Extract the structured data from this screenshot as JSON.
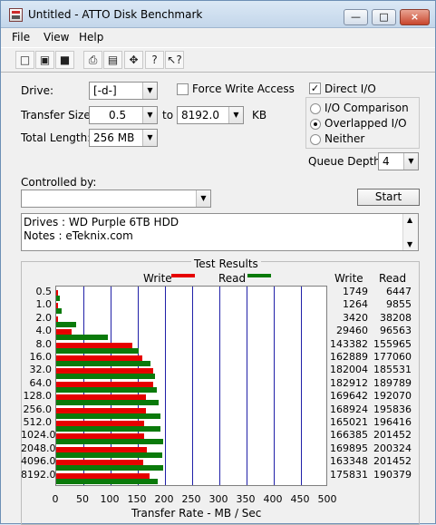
{
  "window": {
    "title": "Untitled - ATTO Disk Benchmark"
  },
  "menu": [
    "File",
    "View",
    "Help"
  ],
  "toolbar": {
    "icons": [
      "new-icon",
      "open-icon",
      "save-icon",
      "print-icon",
      "print-preview-icon",
      "move-icon",
      "help-icon",
      "context-help-icon"
    ]
  },
  "drive": {
    "label": "Drive:",
    "value": "[-d-]"
  },
  "force_write_access": {
    "label": "Force Write Access",
    "checked": false
  },
  "direct_io": {
    "label": "Direct I/O",
    "checked": true,
    "mark": "✓"
  },
  "transfer_size": {
    "label": "Transfer Size:",
    "from": "0.5",
    "to_label": "to",
    "to": "8192.0",
    "unit": "KB"
  },
  "total_length": {
    "label": "Total Length:",
    "value": "256 MB"
  },
  "io_mode": {
    "options": [
      {
        "label": "I/O Comparison",
        "selected": false
      },
      {
        "label": "Overlapped I/O",
        "selected": true
      },
      {
        "label": "Neither",
        "selected": false
      }
    ]
  },
  "queue_depth": {
    "label": "Queue Depth:",
    "value": "4"
  },
  "controlled_by": {
    "label": "Controlled by:",
    "value": ""
  },
  "start_button": "Start",
  "notes": {
    "line1": "Drives : WD Purple 6TB HDD",
    "line2": "Notes :  eTeknix.com"
  },
  "results": {
    "title": "Test Results",
    "legend": {
      "write": "Write",
      "read": "Read",
      "write_color": "#e60000",
      "read_color": "#0a7a0a"
    },
    "columns": {
      "write": "Write",
      "read": "Read"
    },
    "axis_label": "Transfer Rate - MB / Sec",
    "axis_ticks": [
      "0",
      "50",
      "100",
      "150",
      "200",
      "250",
      "300",
      "350",
      "400",
      "450",
      "500"
    ],
    "axis_max": 500,
    "rows": [
      {
        "size": "0.5",
        "write": 1749,
        "read": 6447
      },
      {
        "size": "1.0",
        "write": 1264,
        "read": 9855
      },
      {
        "size": "2.0",
        "write": 3420,
        "read": 38208
      },
      {
        "size": "4.0",
        "write": 29460,
        "read": 96563
      },
      {
        "size": "8.0",
        "write": 143382,
        "read": 155965
      },
      {
        "size": "16.0",
        "write": 162889,
        "read": 177060
      },
      {
        "size": "32.0",
        "write": 182004,
        "read": 185531
      },
      {
        "size": "64.0",
        "write": 182912,
        "read": 189789
      },
      {
        "size": "128.0",
        "write": 169642,
        "read": 192070
      },
      {
        "size": "256.0",
        "write": 168924,
        "read": 195836
      },
      {
        "size": "512.0",
        "write": 165021,
        "read": 196416
      },
      {
        "size": "1024.0",
        "write": 166385,
        "read": 201452
      },
      {
        "size": "2048.0",
        "write": 169895,
        "read": 200324
      },
      {
        "size": "4096.0",
        "write": 163348,
        "read": 201452
      },
      {
        "size": "8192.0",
        "write": 175831,
        "read": 190379
      }
    ]
  }
}
